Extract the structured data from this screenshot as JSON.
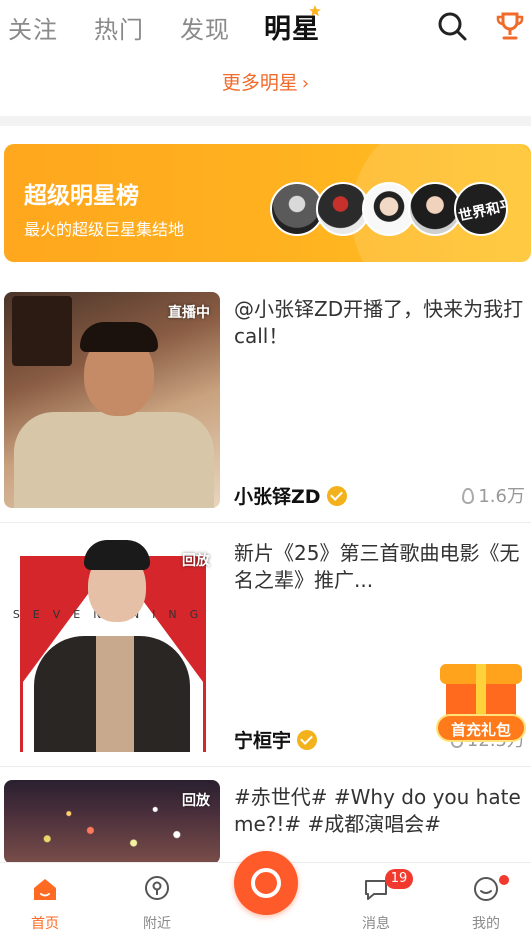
{
  "top_tabs": [
    {
      "label": "关注",
      "active": false
    },
    {
      "label": "热门",
      "active": false
    },
    {
      "label": "发现",
      "active": false
    },
    {
      "label": "明星",
      "active": true
    }
  ],
  "more_stars_link": "更多明星",
  "banner": {
    "title": "超级明星榜",
    "subtitle": "最火的超级巨星集结地",
    "avatar_5_text": "世界和平"
  },
  "feed": [
    {
      "badge": "直播中",
      "title": "@小张铎ZD开播了，快来为我打call！",
      "name": "小张铎ZD",
      "count": "1.6万"
    },
    {
      "badge": "回放",
      "title": "新片《25》第三首歌曲电影《无名之辈》推广...",
      "name": "宁桓宇",
      "count": "12.5万",
      "poster_text": "SEVEN NING"
    },
    {
      "badge": "回放",
      "title": "#赤世代# #Why do you hate me?!# #成都演唱会#"
    }
  ],
  "gift": {
    "label": "首充礼包"
  },
  "bottom_nav": {
    "home": "首页",
    "nearby": "附近",
    "messages": "消息",
    "messages_badge": "19",
    "me": "我的"
  },
  "colors": {
    "accent": "#ff6a22",
    "banner": "#ffb21f",
    "badge_red": "#f2392e",
    "verified": "#f3b21c"
  },
  "icons": [
    "search-icon",
    "trophy-icon",
    "chevron-right-icon",
    "flame-icon",
    "home-icon",
    "location-icon",
    "message-icon",
    "profile-icon"
  ]
}
